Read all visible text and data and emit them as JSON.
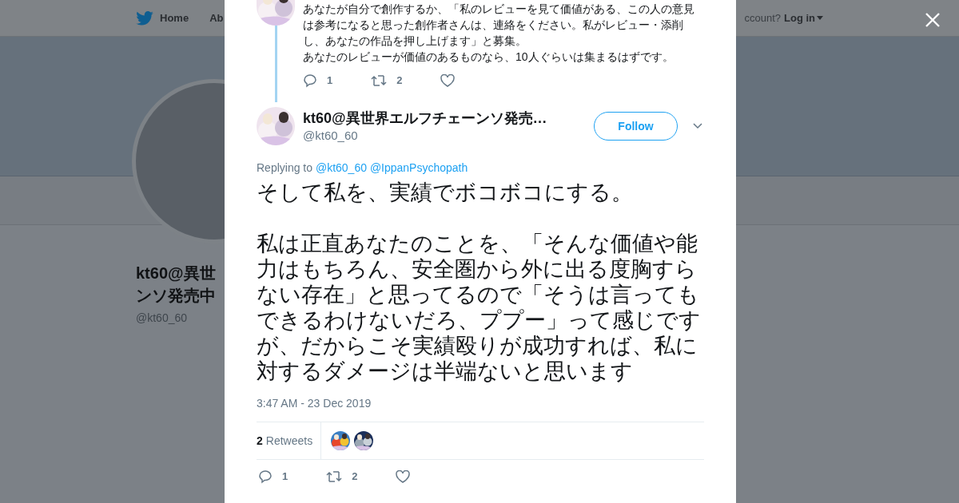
{
  "nav": {
    "items": [
      {
        "label": "Home"
      },
      {
        "label": "Ab"
      }
    ],
    "account_prompt": "ccount?",
    "login": "Log in"
  },
  "profile": {
    "name_lines": [
      "kt60@異世",
      "ンソ発売中"
    ],
    "handle": "@kt60_60"
  },
  "modal": {
    "parent_tweet": {
      "lines": [
        "あなたが自分で創作するか、「私のレビューを見て価値がある、この人の意見は参考になると思った創作者さんは、連絡をください。私がレビュー・添削し、あなたの作品を押し上げます」と募集。",
        "あなたのレビューが価値のあるものなら、10人ぐらいは集まるはずです。"
      ],
      "replies": "1",
      "retweets": "2"
    },
    "tweet": {
      "name": "kt60@異世界エルフチェーンソ発売…",
      "handle": "@kt60_60",
      "follow": "Follow",
      "replying_label": "Replying to",
      "replying_to": [
        "@kt60_60",
        "@IppanPsychopath"
      ],
      "paragraphs": [
        "そして私を、実績でボコボコにする。",
        "私は正直あなたのことを、「そんな価値や能力はもちろん、安全圏から外に出る度胸すらない存在」と思ってるので「そうは言ってもできるわけないだろ、ププー」って感じですが、だからこそ実績殴りが成功すれば、私に対するダメージは半端ないと思います"
      ],
      "time": "3:47 AM - 23 Dec 2019",
      "retweet_count": "2",
      "retweet_label": "Retweets",
      "replies": "1",
      "retweets": "2"
    }
  }
}
